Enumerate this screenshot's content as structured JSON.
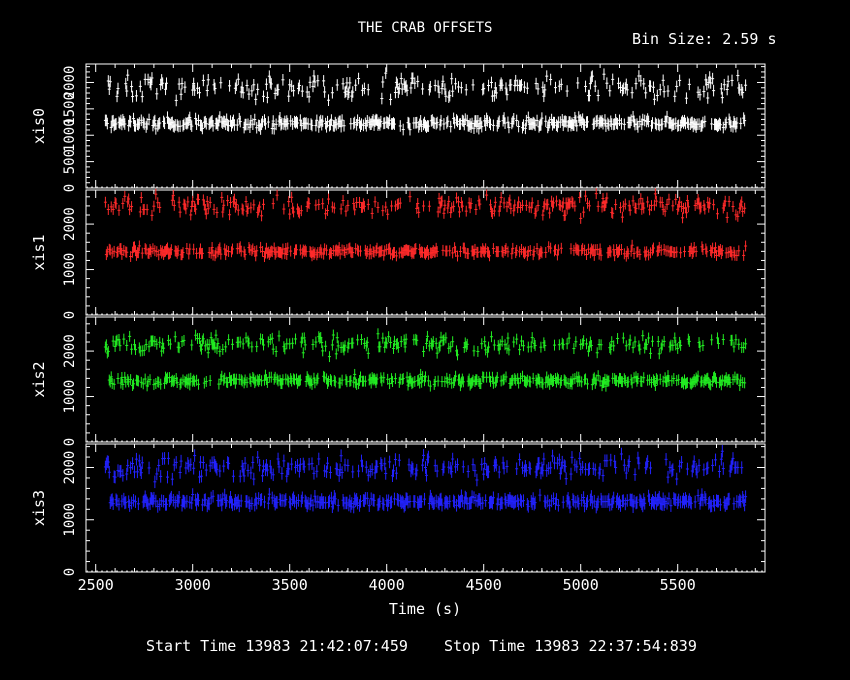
{
  "header": {
    "title": "THE CRAB OFFSETS",
    "bin_size": "Bin Size: 2.59 s"
  },
  "footer": {
    "start_time": "Start Time 13983 21:42:07:459",
    "stop_time": "Stop Time 13983 22:37:54:839"
  },
  "chart_data": {
    "type": "scatter",
    "title": "THE CRAB OFFSETS",
    "xlabel": "Time (s)",
    "xlim": [
      2450,
      5950
    ],
    "x_ticks": [
      2500,
      3000,
      3500,
      4000,
      4500,
      5000,
      5500
    ],
    "x_tick_labels": [
      "2500",
      "3000",
      "3500",
      "4000",
      "4500",
      "5000",
      "5500"
    ],
    "data_range": [
      2550,
      5850
    ],
    "bin_size_s": 2.59,
    "error_bars": true,
    "panels": [
      {
        "ylabel": "xis0",
        "color": "#ffffff",
        "ylim": [
          0,
          2350
        ],
        "y_ticks": [
          0,
          500,
          1000,
          1500,
          2000
        ],
        "y_tick_labels": [
          "0",
          "500",
          "1000",
          "1500",
          "2000"
        ],
        "low_level_mean": 1230,
        "high_level_mean": 1900,
        "err": 110
      },
      {
        "ylabel": "xis1",
        "color": "#ff2a2a",
        "ylim": [
          0,
          2750
        ],
        "y_ticks": [
          0,
          1000,
          2000
        ],
        "y_tick_labels": [
          "0",
          "1000",
          "2000"
        ],
        "low_level_mean": 1400,
        "high_level_mean": 2400,
        "err": 120
      },
      {
        "ylabel": "xis2",
        "color": "#22ee22",
        "ylim": [
          0,
          2750
        ],
        "y_ticks": [
          0,
          1000,
          2000
        ],
        "y_tick_labels": [
          "0",
          "1000",
          "2000"
        ],
        "low_level_mean": 1350,
        "high_level_mean": 2150,
        "err": 120
      },
      {
        "ylabel": "xis3",
        "color": "#2222ff",
        "ylim": [
          0,
          2450
        ],
        "y_ticks": [
          0,
          1000,
          2000
        ],
        "y_tick_labels": [
          "0",
          "1000",
          "2000"
        ],
        "low_level_mean": 1350,
        "high_level_mean": 2000,
        "err": 120
      }
    ]
  }
}
